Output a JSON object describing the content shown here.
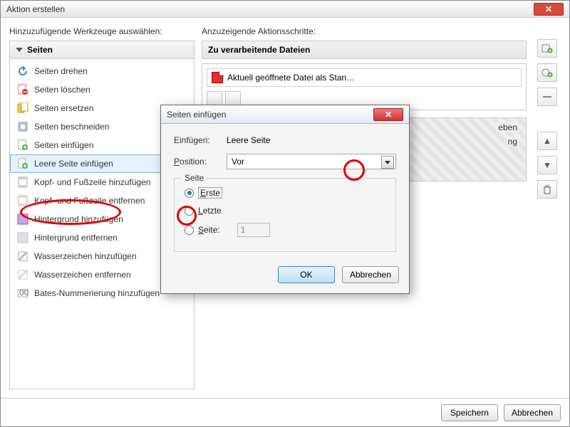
{
  "window": {
    "title": "Aktion erstellen"
  },
  "left": {
    "label": "Hinzuzufügende Werkzeuge auswählen:",
    "panel_title": "Seiten",
    "tools": [
      "Seiten drehen",
      "Seiten löschen",
      "Seiten ersetzen",
      "Seiten beschneiden",
      "Seiten einfügen",
      "Leere Seite einfügen",
      "Kopf- und Fußzeile hinzufügen",
      "Kopf- und Fußzeile entfernen",
      "Hintergrund hinzufügen",
      "Hintergrund entfernen",
      "Wasserzeichen hinzufügen",
      "Wasserzeichen entfernen",
      "Bates-Nummerierung hinzufügen"
    ],
    "selected_index": 5
  },
  "right": {
    "label": "Anzuzeigende Aktionsschritte:",
    "steps_title": "Zu verarbeitende Dateien",
    "file_row": "Aktuell geöffnete Datei als Stan…",
    "frag1": "eben",
    "frag2": "ng"
  },
  "footer": {
    "save": "Speichern",
    "cancel": "Abbrechen"
  },
  "dialog": {
    "title": "Seiten einfügen",
    "insert_label": "Einfügen:",
    "insert_value": "Leere Seite",
    "position_label": "Position:",
    "position_value": "Vor",
    "group_title": "Seite",
    "radio_first": "Erste",
    "radio_last": "Letzte",
    "radio_page": "Seite:",
    "page_value": "1",
    "ok": "OK",
    "cancel": "Abbrechen"
  }
}
